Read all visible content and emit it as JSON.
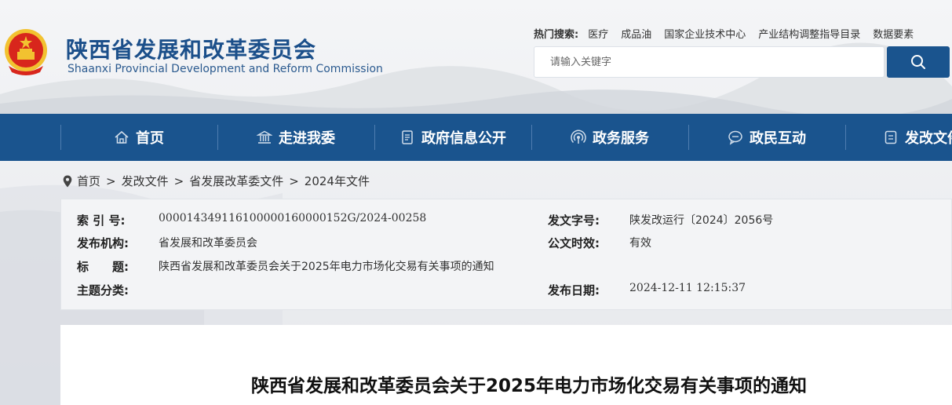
{
  "header": {
    "title_cn": "陕西省发展和改革委员会",
    "title_en": "Shaanxi Provincial Development and Reform Commission",
    "hot_search_label": "热门搜索:",
    "hot_search_links": [
      "医疗",
      "成品油",
      "国家企业技术中心",
      "产业结构调整指导目录",
      "数据要素"
    ],
    "search_placeholder": "请输入关键字",
    "search_icon": "search-icon"
  },
  "nav": {
    "items": [
      {
        "label": "首页",
        "icon": "home-icon"
      },
      {
        "label": "走进我委",
        "icon": "building-icon"
      },
      {
        "label": "政府信息公开",
        "icon": "document-icon"
      },
      {
        "label": "政务服务",
        "icon": "broadcast-icon"
      },
      {
        "label": "政民互动",
        "icon": "chat-icon"
      },
      {
        "label": "发改文件",
        "icon": "file-icon"
      }
    ]
  },
  "breadcrumb": {
    "icon": "location-pin-icon",
    "items": [
      "首页",
      "发改文件",
      "省发展改革委文件",
      "2024年文件"
    ],
    "separator": ">"
  },
  "meta": {
    "index_label": "索 引 号:",
    "index_value": "000014349116100000160000152G/2024-00258",
    "doc_no_label": "发文字号:",
    "doc_no_value": "陕发改运行〔2024〕2056号",
    "publisher_label": "发布机构:",
    "publisher_value": "省发展和改革委员会",
    "validity_label": "公文时效:",
    "validity_value": "有效",
    "title_label": "标　　题:",
    "title_value": "陕西省发展和改革委员会关于2025年电力市场化交易有关事项的通知",
    "topic_label": "主题分类:",
    "topic_value": "",
    "date_label": "发布日期:",
    "date_value": "2024-12-11 12:15:37"
  },
  "content": {
    "doc_title": "陕西省发展和改革委员会关于2025年电力市场化交易有关事项的通知"
  },
  "colors": {
    "brand_blue": "#1a548e",
    "emblem_red": "#d8261c",
    "emblem_gold": "#f2c230"
  }
}
